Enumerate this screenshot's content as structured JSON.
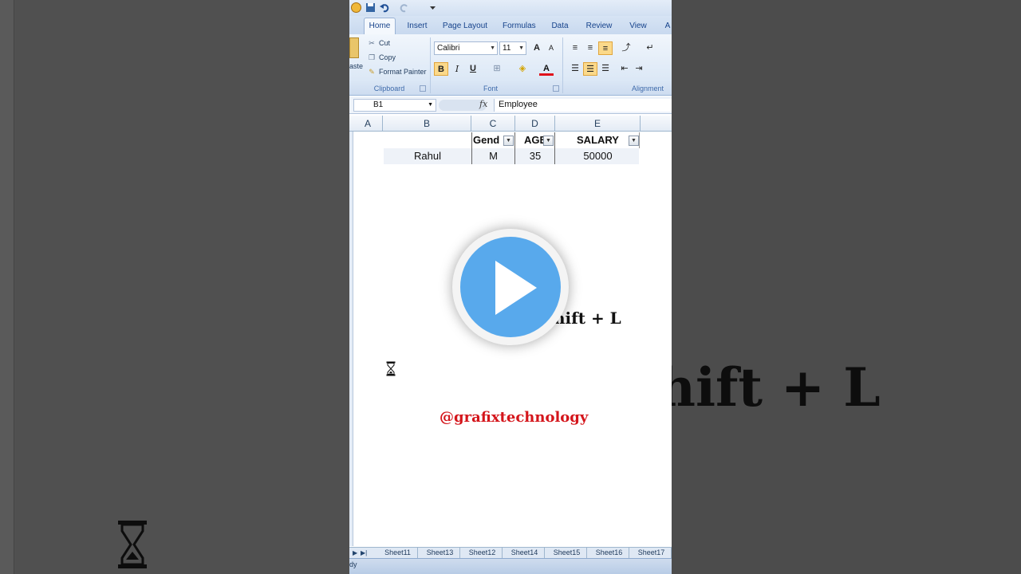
{
  "ribbon": {
    "tabs": [
      {
        "label": "Home",
        "active": true
      },
      {
        "label": "Insert"
      },
      {
        "label": "Page Layout"
      },
      {
        "label": "Formulas"
      },
      {
        "label": "Data"
      },
      {
        "label": "Review"
      },
      {
        "label": "View"
      },
      {
        "label": "A"
      }
    ],
    "clipboard": {
      "paste_label": "aste",
      "cut": "Cut",
      "copy": "Copy",
      "format_painter": "Format Painter",
      "group_label": "Clipboard"
    },
    "font": {
      "font_name": "Calibri",
      "font_size": "11",
      "bold": "B",
      "italic": "I",
      "underline": "U",
      "grow": "A",
      "shrink": "A",
      "font_color_glyph": "A",
      "group_label": "Font"
    },
    "alignment": {
      "group_label": "Alignment"
    }
  },
  "formula_bar": {
    "name_box": "B1",
    "fx": "fx",
    "formula": "Employee"
  },
  "grid": {
    "columns": [
      "A",
      "B",
      "C",
      "D",
      "E"
    ],
    "header_row": {
      "gender": "Gend",
      "age": "AGE",
      "salary": "SALARY"
    },
    "data_row": {
      "name": "Rahul",
      "gender": "M",
      "age": "35",
      "salary": "50000"
    }
  },
  "overlay": {
    "shortcut_text": "hift + L",
    "handle": "@grafixtechnology",
    "bg_shortcut_text": "hift + L"
  },
  "sheets": [
    "Sheet11",
    "Sheet13",
    "Sheet12",
    "Sheet14",
    "Sheet15",
    "Sheet16",
    "Sheet17"
  ],
  "status": {
    "text": "dy"
  },
  "colors": {
    "accent_red": "#d4151b",
    "play_blue": "#58a9ec",
    "ribbon_text": "#15428b"
  }
}
